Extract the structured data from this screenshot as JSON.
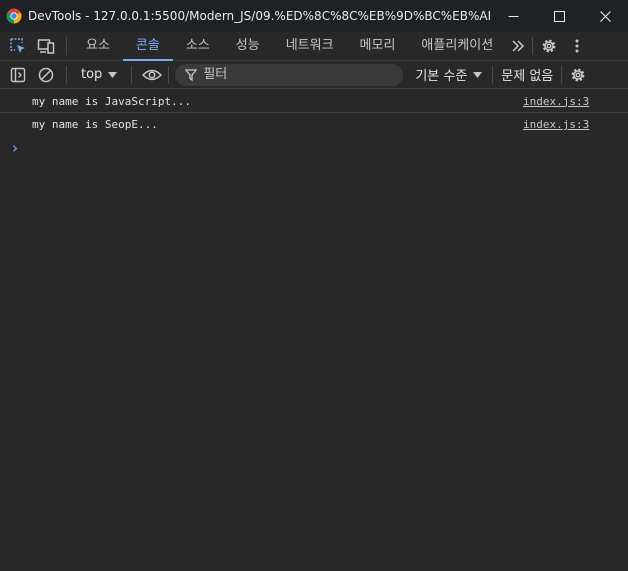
{
  "window": {
    "title": "DevTools - 127.0.0.1:5500/Modern_JS/09.%ED%8C%8C%EB%9D%BC%EB%AF%B8%...",
    "controls": [
      "minimize-icon",
      "maximize-icon",
      "close-icon"
    ]
  },
  "tabs": [
    {
      "label": "요소",
      "active": false
    },
    {
      "label": "콘솔",
      "active": true
    },
    {
      "label": "소스",
      "active": false
    },
    {
      "label": "성능",
      "active": false
    },
    {
      "label": "네트워크",
      "active": false
    },
    {
      "label": "메모리",
      "active": false
    },
    {
      "label": "애플리케이션",
      "active": false
    }
  ],
  "toolbar": {
    "context": "top",
    "filter_placeholder": "필터",
    "levels": "기본 수준",
    "issues": "문제 없음"
  },
  "console": {
    "messages": [
      {
        "text": "my name is JavaScript...",
        "source": "index.js:3"
      },
      {
        "text": "my name is SeopE...",
        "source": "index.js:3"
      }
    ],
    "prompt": "›"
  },
  "colors": {
    "accent": "#7cacf8",
    "background": "#282828",
    "titlebar": "#202124"
  }
}
